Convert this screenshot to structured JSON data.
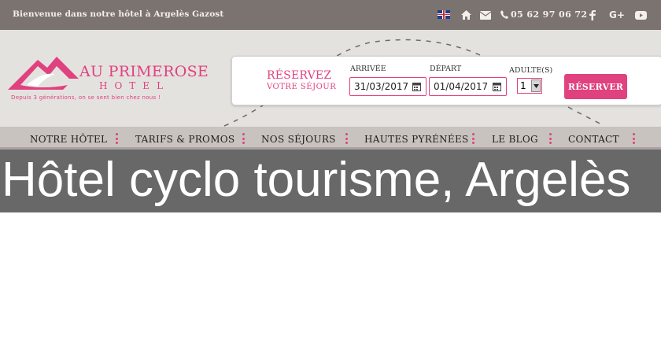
{
  "topbar": {
    "welcome": "Bienvenue dans notre hôtel à Argelès Gazost",
    "phone": "05 62 97 06 72",
    "icons": [
      "uk-flag-icon",
      "home-icon",
      "mail-icon",
      "phone-icon",
      "facebook-icon",
      "google-plus-icon",
      "youtube-icon"
    ]
  },
  "logo": {
    "brand": "AU PRIMEROSE",
    "hotel": "HOTEL",
    "tagline": "Depuis 3 générations, on se sent bien chez nous !"
  },
  "booking": {
    "title": "RÉSERVEZ",
    "subtitle": "VOTRE SÉJOUR",
    "arrival_label": "ARRIVÉE",
    "arrival_value": "31/03/2017",
    "departure_label": "DÉPART",
    "departure_value": "01/04/2017",
    "adults_label": "ADULTE(S)",
    "adults_value": "1",
    "submit_label": "RÉSERVER"
  },
  "nav": {
    "items": [
      "NOTRE HÔTEL",
      "TARIFS & PROMOS",
      "NOS SÉJOURS",
      "HAUTES PYRÉNÉES",
      "LE BLOG",
      "CONTACT"
    ]
  },
  "page": {
    "title": "Hôtel cyclo tourisme, Argelès"
  },
  "colors": {
    "accent": "#e0417f",
    "topbar": "#7b7370",
    "header": "#e4e2df",
    "nav": "#c9c3bf",
    "banner": "#686868"
  }
}
